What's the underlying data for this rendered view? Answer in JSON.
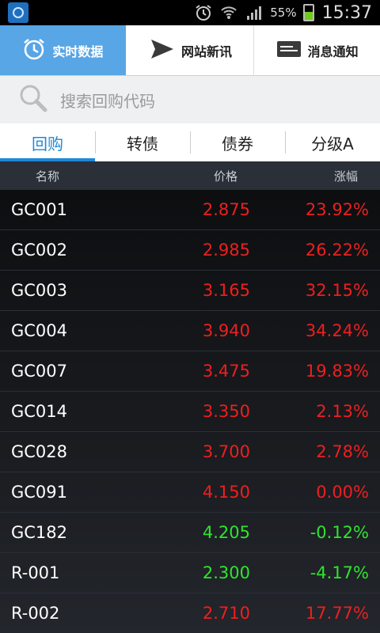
{
  "status_bar": {
    "battery_pct": "55%",
    "battery_level": 0.55,
    "time": "15:37",
    "icons": [
      "app-icon",
      "alarm-icon",
      "wifi-icon",
      "signal-icon",
      "battery-icon"
    ]
  },
  "top_nav": {
    "tabs": [
      {
        "label": "实时数据",
        "icon": "clock-icon",
        "active": true
      },
      {
        "label": "网站新讯",
        "icon": "send-icon",
        "active": false
      },
      {
        "label": "消息通知",
        "icon": "message-icon",
        "active": false
      }
    ]
  },
  "search": {
    "placeholder": "搜索回购代码",
    "icon": "search-icon"
  },
  "segments": [
    {
      "label": "回购",
      "active": true
    },
    {
      "label": "转债",
      "active": false
    },
    {
      "label": "债券",
      "active": false
    },
    {
      "label": "分级A",
      "active": false
    }
  ],
  "table": {
    "headers": {
      "name": "名称",
      "price": "价格",
      "change": "涨幅"
    },
    "colors": {
      "up": "#ee1f1f",
      "down": "#2ee52e"
    },
    "rows": [
      {
        "name": "GC001",
        "price": "2.875",
        "change": "23.92%",
        "dir": "up"
      },
      {
        "name": "GC002",
        "price": "2.985",
        "change": "26.22%",
        "dir": "up"
      },
      {
        "name": "GC003",
        "price": "3.165",
        "change": "32.15%",
        "dir": "up"
      },
      {
        "name": "GC004",
        "price": "3.940",
        "change": "34.24%",
        "dir": "up"
      },
      {
        "name": "GC007",
        "price": "3.475",
        "change": "19.83%",
        "dir": "up"
      },
      {
        "name": "GC014",
        "price": "3.350",
        "change": "2.13%",
        "dir": "up"
      },
      {
        "name": "GC028",
        "price": "3.700",
        "change": "2.78%",
        "dir": "up"
      },
      {
        "name": "GC091",
        "price": "4.150",
        "change": "0.00%",
        "dir": "up"
      },
      {
        "name": "GC182",
        "price": "4.205",
        "change": "-0.12%",
        "dir": "down"
      },
      {
        "name": "R-001",
        "price": "2.300",
        "change": "-4.17%",
        "dir": "down"
      },
      {
        "name": "R-002",
        "price": "2.710",
        "change": "17.77%",
        "dir": "up"
      }
    ]
  }
}
